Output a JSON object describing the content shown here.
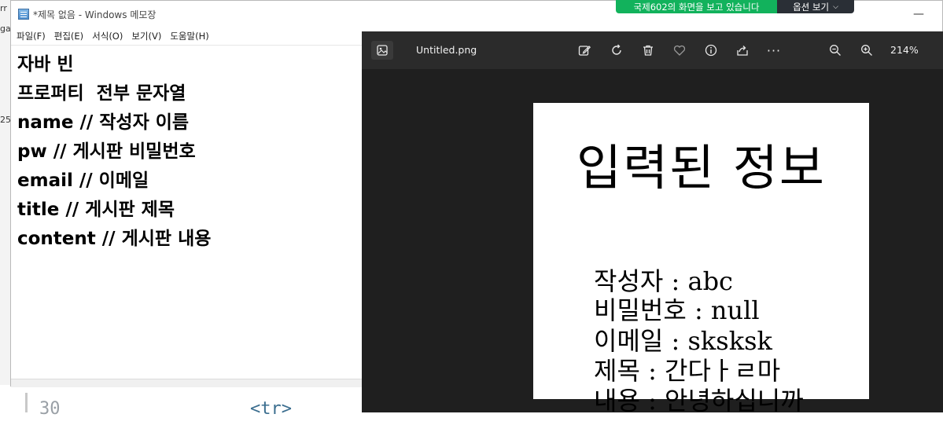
{
  "background": {
    "line_number": "30",
    "code_fragment": "<tr>",
    "left_fragments": [
      "rr",
      "ga",
      "25"
    ]
  },
  "notepad": {
    "title": "*제목 없음 - Windows 메모장",
    "menu": [
      "파일(F)",
      "편집(E)",
      "서식(O)",
      "보기(V)",
      "도움말(H)"
    ],
    "lines": [
      "자바 빈",
      "프로퍼티  전부 문자열",
      "name // 작성자 이름",
      "pw // 게시판 비밀번호",
      "email // 이메일",
      "title // 게시판 제목",
      "content // 게시판 내용"
    ]
  },
  "share_banner": {
    "text": "국제602의 화면을 보고 있습니다",
    "options_label": "옵션 보기"
  },
  "viewer": {
    "filename": "Untitled.png",
    "zoom": "214%",
    "toolbar_icons": [
      "gallery-icon",
      "edit-icon",
      "rotate-icon",
      "delete-icon",
      "favorite-icon",
      "info-icon",
      "share-icon",
      "more-icon",
      "zoom-out-icon",
      "zoom-in-icon"
    ],
    "image": {
      "title": "입력된 정보",
      "rows": [
        {
          "label": "작성자",
          "sep": " : ",
          "value": "abc"
        },
        {
          "label": "비밀번호",
          "sep": " : ",
          "value": "null"
        },
        {
          "label": "이메일",
          "sep": " : ",
          "value": "sksksk"
        },
        {
          "label": "제목",
          "sep": " : ",
          "value": "간다ㅏㄹ마"
        },
        {
          "label": "내용",
          "sep": " : ",
          "value": "안녕하십니까"
        }
      ]
    }
  }
}
